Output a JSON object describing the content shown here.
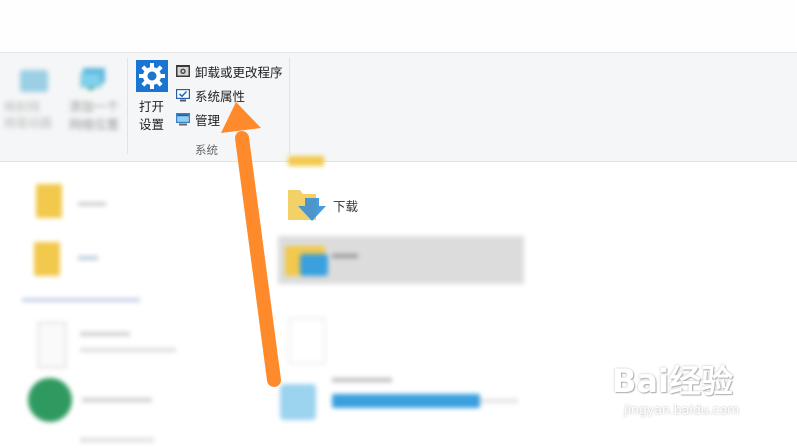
{
  "ribbon": {
    "network_group": {
      "map_drive_label_line1": "映射网",
      "map_drive_label_line2": "络驱动器",
      "add_location_line1": "添加一个",
      "add_location_line2": "网络位置"
    },
    "system_group": {
      "open_settings_line1": "打开",
      "open_settings_line2": "设置",
      "uninstall_label": "卸载或更改程序",
      "system_properties_label": "系统属性",
      "manage_label": "管理",
      "group_label": "系统"
    }
  },
  "files": {
    "download_label": "下载"
  },
  "watermark": {
    "logo": "Bai经验",
    "url": "jingyan.baidu.com"
  },
  "colors": {
    "arrow": "#ff8a2b",
    "settings_tile": "#1a74d1",
    "ribbon_bg": "#f5f6f7"
  },
  "icons": [
    "gear-icon",
    "uninstall-icon",
    "system-properties-icon",
    "manage-icon",
    "network-icon",
    "add-network-location-icon",
    "folder-icon",
    "download-folder-icon"
  ]
}
